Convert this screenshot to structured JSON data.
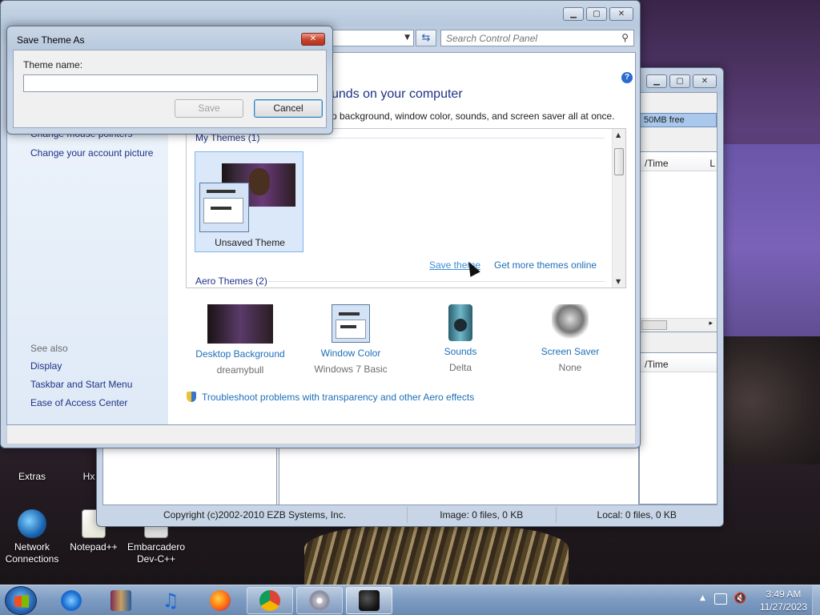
{
  "desktop": {
    "icons": [
      {
        "label": "Extras"
      },
      {
        "label": "Hx"
      },
      {
        "label": "Network Connections"
      },
      {
        "label": "Notepad++"
      },
      {
        "label": "Embarcadero Dev-C++"
      }
    ]
  },
  "ezb_window": {
    "free_space": "50MB free",
    "col_time_1": "/Time",
    "col_l": "L",
    "col_time_2": "/Time",
    "status": {
      "copyright": "Copyright (c)2002-2010 EZB Systems, Inc.",
      "image": "Image: 0 files, 0 KB",
      "local": "Local: 0 files, 0 KB"
    }
  },
  "control_panel": {
    "search_placeholder": "Search Control Panel",
    "heading": "unds on your computer",
    "description": "p background, window color, sounds, and screen saver all at once.",
    "sidebar": {
      "partial_link": "Change mouse pointers",
      "account_picture": "Change your account picture",
      "see_also": "See also",
      "links": [
        "Display",
        "Taskbar and Start Menu",
        "Ease of Access Center"
      ]
    },
    "themes": {
      "my_themes": "My Themes (1)",
      "unsaved_theme": "Unsaved Theme",
      "save_theme": "Save theme",
      "get_more": "Get more themes online",
      "aero_themes": "Aero Themes (2)"
    },
    "bottom": [
      {
        "label": "Desktop Background",
        "sub": "dreamybull",
        "icon": "wallpaper-icon"
      },
      {
        "label": "Window Color",
        "sub": "Windows 7 Basic",
        "icon": "window-color-icon"
      },
      {
        "label": "Sounds",
        "sub": "Delta",
        "icon": "speaker-icon"
      },
      {
        "label": "Screen Saver",
        "sub": "None",
        "icon": "screensaver-icon"
      }
    ],
    "troubleshoot": "Troubleshoot problems with transparency and other Aero effects"
  },
  "dialog": {
    "title": "Save Theme As",
    "label": "Theme name:",
    "value": "",
    "save": "Save",
    "cancel": "Cancel"
  },
  "taskbar": {
    "time": "3:49 AM",
    "date": "11/27/2023"
  }
}
